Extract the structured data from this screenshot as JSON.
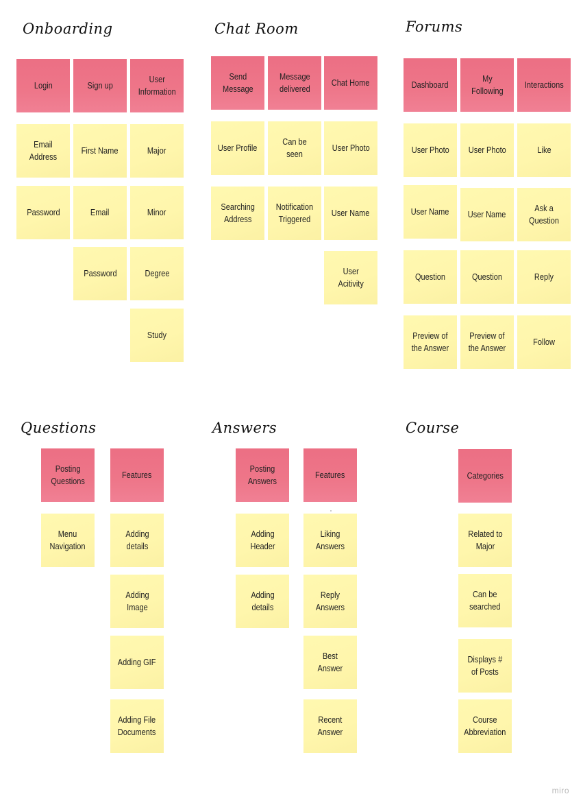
{
  "board": {
    "watermark": "miro",
    "colors": {
      "pink_note": "#ee7489",
      "yellow_note": "#fff6ac",
      "text": "#222222"
    },
    "sections": [
      {
        "title": "Onboarding",
        "headers": [
          "Login",
          "Sign up",
          "User\nInformation"
        ],
        "columns": [
          [
            "Email\nAddress",
            "Password"
          ],
          [
            "First Name",
            "Email",
            "Password"
          ],
          [
            "Major",
            "Minor",
            "Degree",
            "Study"
          ]
        ]
      },
      {
        "title": "Chat Room",
        "headers": [
          "Send\nMessage",
          "Message\ndelivered",
          "Chat Home"
        ],
        "columns": [
          [
            "User Profile",
            "Searching\nAddress"
          ],
          [
            "Can be seen",
            "Notification\nTriggered"
          ],
          [
            "User Photo",
            "User Name",
            "User\nAcitivity"
          ]
        ]
      },
      {
        "title": "Forums",
        "headers": [
          "Dashboard",
          "My\nFollowing",
          "Interactions"
        ],
        "columns": [
          [
            "User Photo",
            "User Name",
            "Question",
            "Preview of\nthe Answer"
          ],
          [
            "User Photo",
            "User Name",
            "Question",
            "Preview of\nthe Answer"
          ],
          [
            "Like",
            "Ask a\nQuestion",
            "Reply",
            "Follow"
          ]
        ]
      },
      {
        "title": "Questions",
        "headers": [
          "Posting\nQuestions",
          "Features"
        ],
        "columns": [
          [
            "Menu\nNavigation"
          ],
          [
            "Adding\ndetails",
            "Adding\nImage",
            "Adding GIF",
            "Adding File\nDocuments"
          ]
        ]
      },
      {
        "title": "Answers",
        "headers": [
          "Posting\nAnswers",
          "Features"
        ],
        "columns": [
          [
            "Adding\nHeader",
            "Adding\ndetails"
          ],
          [
            "Liking\nAnswers",
            "Reply\nAnswers",
            "Best\nAnswer",
            "Recent\nAnswer"
          ]
        ]
      },
      {
        "title": "Course",
        "headers": [
          "Categories"
        ],
        "columns": [
          [
            "Related to\nMajor",
            "Can be\nsearched",
            "Displays #\nof Posts",
            "Course\nAbbreviation"
          ]
        ]
      }
    ]
  }
}
